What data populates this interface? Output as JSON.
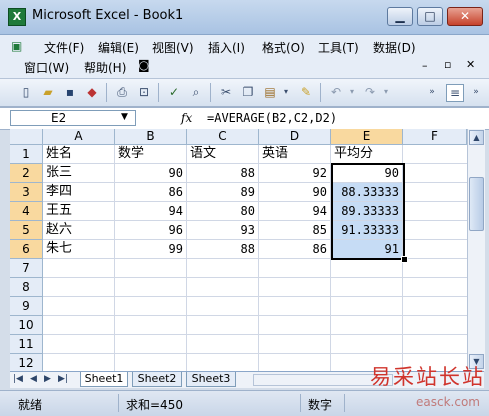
{
  "window": {
    "title": "Microsoft Excel - Book1",
    "icon": "excel-icon",
    "minimize": "minimize-icon",
    "maximize": "maximize-icon",
    "close": "close-icon"
  },
  "menu": {
    "items": [
      "文件(F)",
      "编辑(E)",
      "视图(V)",
      "插入(I)",
      "格式(O)",
      "工具(T)",
      "数据(D)",
      "窗口(W)",
      "帮助(H)"
    ]
  },
  "toolbar": {
    "icons": [
      "new-icon",
      "open-icon",
      "save-icon",
      "permission-icon",
      "print-icon",
      "print-preview-icon",
      "spelling-icon",
      "research-icon",
      "cut-icon",
      "copy-icon",
      "paste-icon",
      "format-painter-icon",
      "undo-icon",
      "redo-icon",
      "align-icon"
    ]
  },
  "formula_bar": {
    "name_box": "E2",
    "fx": "fx",
    "formula": "=AVERAGE(B2,C2,D2)"
  },
  "columns": [
    "A",
    "B",
    "C",
    "D",
    "E",
    "F"
  ],
  "rows": [
    "1",
    "2",
    "3",
    "4",
    "5",
    "6",
    "7",
    "8",
    "9",
    "10",
    "11",
    "12"
  ],
  "cells": {
    "r1": [
      "姓名",
      "数学",
      "语文",
      "英语",
      "平均分"
    ],
    "r2": [
      "张三",
      "90",
      "88",
      "92",
      "90"
    ],
    "r3": [
      "李四",
      "86",
      "89",
      "90",
      "88.33333"
    ],
    "r4": [
      "王五",
      "94",
      "80",
      "94",
      "89.33333"
    ],
    "r5": [
      "赵六",
      "96",
      "93",
      "85",
      "91.33333"
    ],
    "r6": [
      "朱七",
      "99",
      "88",
      "86",
      "91"
    ]
  },
  "sheets": [
    "Sheet1",
    "Sheet2",
    "Sheet3"
  ],
  "status": {
    "ready": "就绪",
    "sum": "求和=450",
    "mode": "数字"
  },
  "watermark": {
    "text": "易采站长站",
    "url": "easck.com"
  }
}
